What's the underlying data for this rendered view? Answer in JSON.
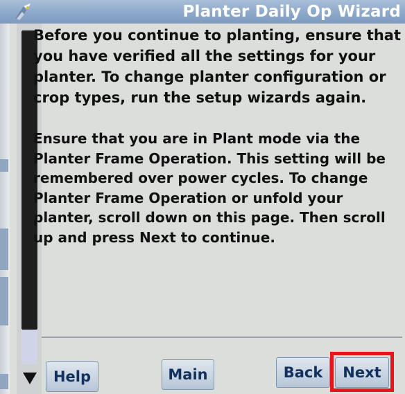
{
  "window": {
    "title": "Planter Daily Op Wizard",
    "title_icon": "planter-wizard-icon"
  },
  "content": {
    "paragraph_1": "Before you continue to planting, ensure that you have verified all the settings for your planter. To change planter configuration or crop types, run the setup wizards again.",
    "paragraph_2": "Ensure that you are in Plant mode via the Planter Frame Operation. This setting will be remembered over power cycles. To change Planter Frame Operation or unfold your planter, scroll down on this page. Then scroll up and press Next to continue."
  },
  "scrollbar": {
    "down_icon": "triangle-down-icon"
  },
  "buttons": {
    "help": "Help",
    "main": "Main",
    "back": "Back",
    "next": "Next"
  },
  "colors": {
    "title_bar": "#8aa6c8",
    "highlight": "#e8141a",
    "button_text": "#12315c"
  }
}
